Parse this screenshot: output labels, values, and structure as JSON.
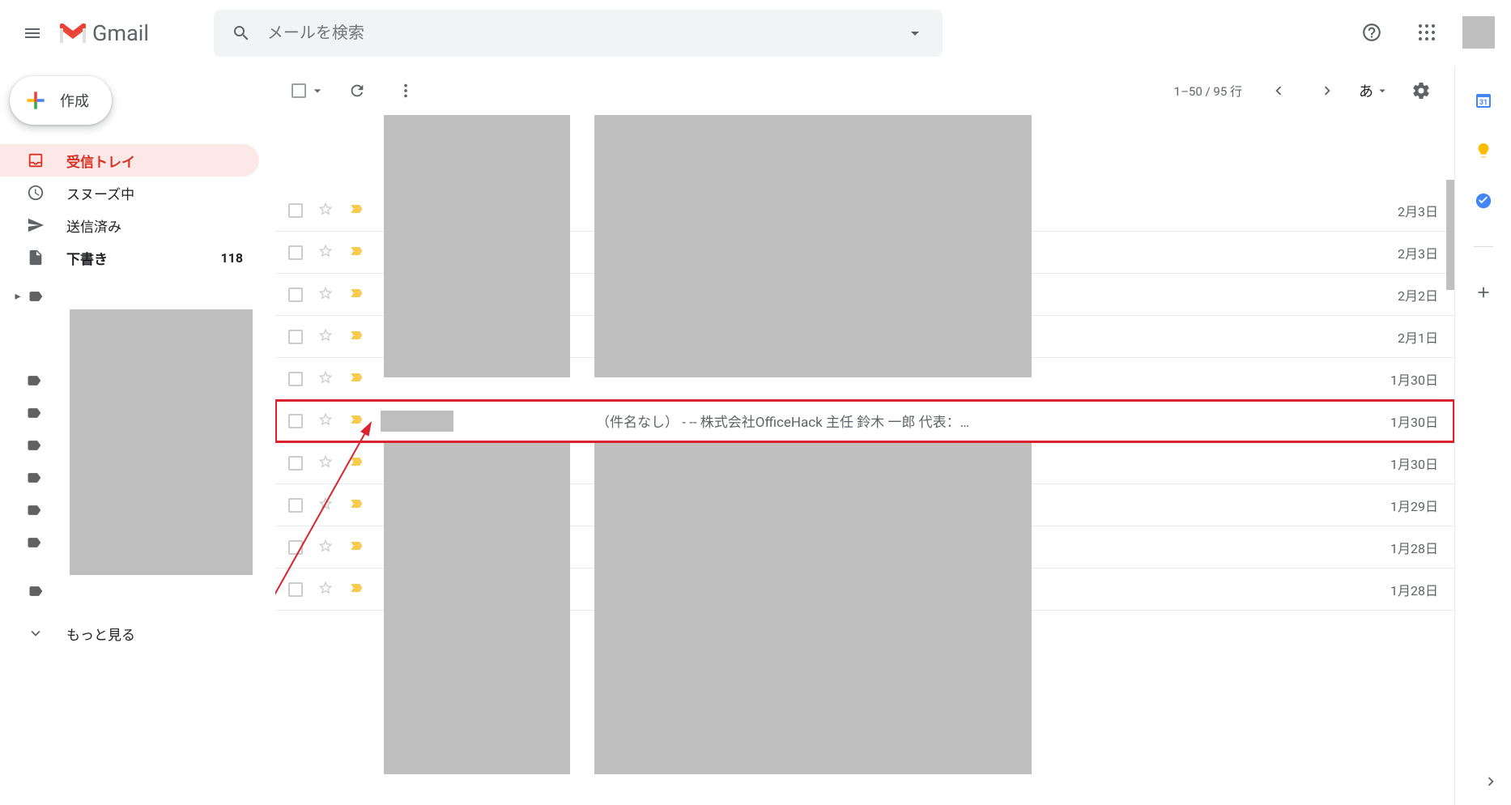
{
  "header": {
    "logo_text": "Gmail",
    "search_placeholder": "メールを検索"
  },
  "compose": {
    "label": "作成"
  },
  "nav": {
    "inbox": "受信トレイ",
    "snoozed": "スヌーズ中",
    "sent": "送信済み",
    "drafts": "下書き",
    "drafts_count": "118",
    "more": "もっと見る"
  },
  "toolbar": {
    "pagination": "1–50 / 95 行",
    "input_method": "あ"
  },
  "emails": [
    {
      "date": "2月3日"
    },
    {
      "date": "2月3日"
    },
    {
      "date": "2月2日"
    },
    {
      "date": "2月1日"
    },
    {
      "date": "1月30日"
    },
    {
      "subject": "（件名なし）  - -- 株式会社OfficeHack 主任 鈴木 一郎 代表：…",
      "date": "1月30日",
      "highlight": true
    },
    {
      "date": "1月30日"
    },
    {
      "date": "1月29日"
    },
    {
      "date": "1月28日"
    },
    {
      "date": "1月28日"
    }
  ]
}
